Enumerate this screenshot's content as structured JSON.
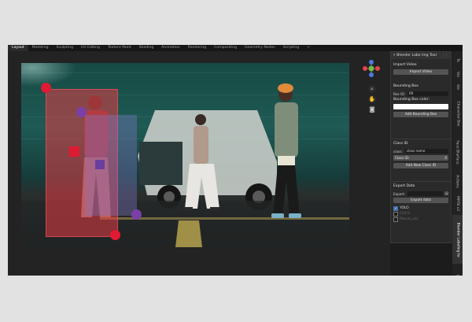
{
  "workspace_tabs": [
    "Layout",
    "Modeling",
    "Sculpting",
    "UV Editing",
    "Texture Paint",
    "Shading",
    "Animation",
    "Rendering",
    "Compositing",
    "Geometry Nodes",
    "Scripting",
    "+"
  ],
  "active_workspace": "Layout",
  "gizmo": {
    "top": "Z",
    "left": "X",
    "right": "X",
    "bottom": "Y",
    "center": "Y"
  },
  "viewport_tools": [
    "zoom-icon",
    "pan-hand-icon",
    "camera-icon"
  ],
  "panel": {
    "title": "Blender Labe ling Tool",
    "import": {
      "title": "Import Video",
      "button": "Import Video"
    },
    "bbox": {
      "title": "Bounding Box",
      "box_id_label": "Box ID:",
      "box_id_value": "00",
      "color_label": "Bounding Box color:",
      "color_value": "#ffffff",
      "add_button": "Add Bounding Box"
    },
    "class": {
      "title": "Class ID",
      "class_label": "class:",
      "class_value": "class name",
      "class_id_label": "Class ID:",
      "class_id_value": "0",
      "add_button": "Add New Class ID"
    },
    "export": {
      "title": "Export Data",
      "export_label": "Export:",
      "export_button": "Export data",
      "formats": [
        {
          "label": "YOLO",
          "checked": true
        },
        {
          "label": "COCO",
          "checked": false
        },
        {
          "label": "Pascal_voc",
          "checked": false
        }
      ]
    }
  },
  "side_tabs": [
    "Te",
    "Vie",
    "Vie",
    "Character Box",
    "Face Blurface",
    "Actions",
    "MPFB v2",
    "Blender Labeling to",
    "Virtual Golden to"
  ],
  "active_side_tab": "Blender Labeling to",
  "colors": {
    "bbox_main": "#e43c46",
    "bbox_second": "#8278c8",
    "handle_red": "#e01a32",
    "handle_purple": "#7b3fa8",
    "gizmo_x": "#e0464b",
    "gizmo_y": "#6fbf4a",
    "gizmo_z": "#4a7be0"
  }
}
